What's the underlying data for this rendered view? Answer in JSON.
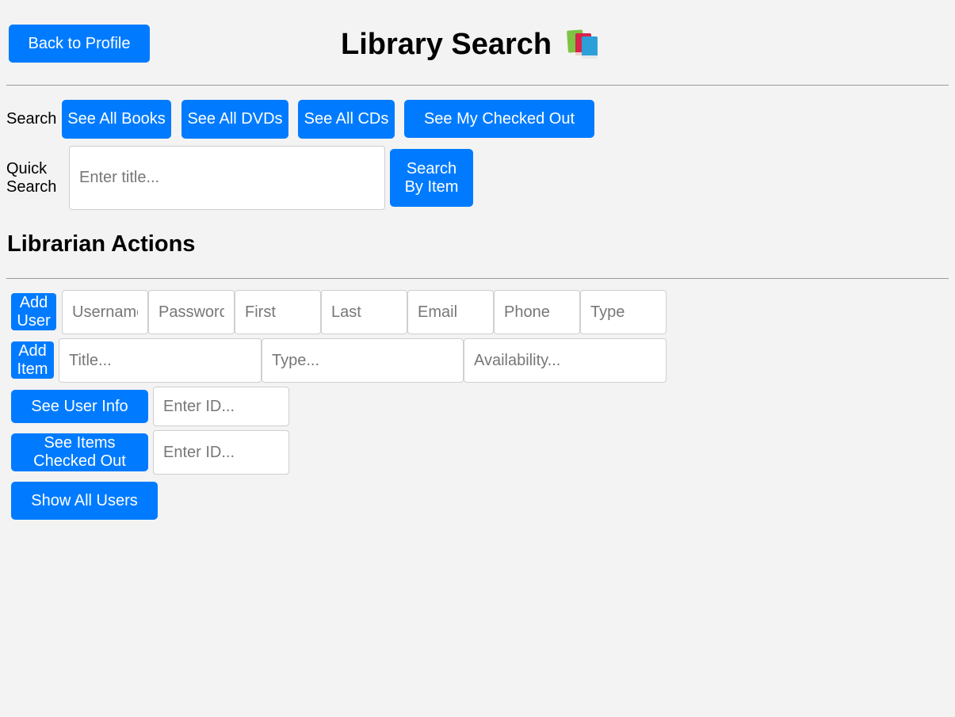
{
  "header": {
    "back_label": "Back to Profile",
    "title": "Library Search",
    "title_icon": "books-icon"
  },
  "search": {
    "label": "Search",
    "buttons": {
      "all_books": "See All Books",
      "all_dvds": "See All DVDs",
      "all_cds": "See All CDs",
      "my_checked_out": "See My Checked Out"
    }
  },
  "quick_search": {
    "label": "Quick Search",
    "placeholder": "Enter title...",
    "button_label": "Search By Item"
  },
  "librarian": {
    "heading": "Librarian Actions",
    "add_user": {
      "button_label": "Add User",
      "fields": {
        "username": "Username",
        "password": "Password",
        "first": "First",
        "last": "Last",
        "email": "Email",
        "phone": "Phone",
        "type": "Type"
      }
    },
    "add_item": {
      "button_label": "Add Item",
      "fields": {
        "title": "Title...",
        "type": "Type...",
        "availability": "Availability..."
      }
    },
    "user_info": {
      "button_label": "See User Info",
      "placeholder": "Enter ID..."
    },
    "items_checked_out": {
      "button_label": "See Items Checked Out",
      "placeholder": "Enter ID..."
    },
    "show_all_users_label": "Show All Users"
  },
  "colors": {
    "accent": "#007bff",
    "background": "#f3f3f3"
  }
}
